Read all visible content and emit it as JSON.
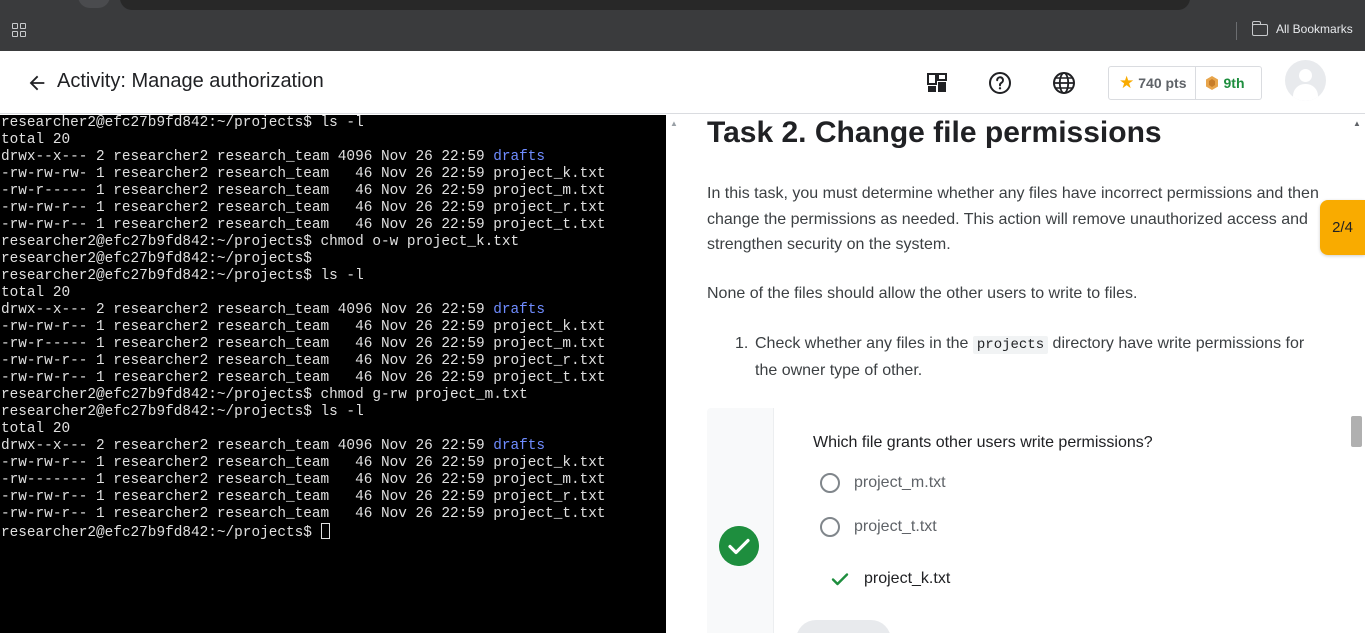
{
  "bookmarks_bar": {
    "all_bookmarks_label": "All Bookmarks"
  },
  "header": {
    "title": "Activity: Manage authorization",
    "points": "740 pts",
    "rank": "9th"
  },
  "terminal": {
    "lines": [
      [
        {
          "t": "researcher2@efc27b9fd842:~/projects$ ls -l"
        }
      ],
      [
        {
          "t": "total 20"
        }
      ],
      [
        {
          "t": "drwx--x--- 2 researcher2 research_team 4096 Nov 26 22:59 "
        },
        {
          "t": "drafts",
          "c": "dir"
        }
      ],
      [
        {
          "t": "-rw-rw-rw- 1 researcher2 research_team   46 Nov 26 22:59 project_k.txt"
        }
      ],
      [
        {
          "t": "-rw-r----- 1 researcher2 research_team   46 Nov 26 22:59 project_m.txt"
        }
      ],
      [
        {
          "t": "-rw-rw-r-- 1 researcher2 research_team   46 Nov 26 22:59 project_r.txt"
        }
      ],
      [
        {
          "t": "-rw-rw-r-- 1 researcher2 research_team   46 Nov 26 22:59 project_t.txt"
        }
      ],
      [
        {
          "t": "researcher2@efc27b9fd842:~/projects$ chmod o-w project_k.txt"
        }
      ],
      [
        {
          "t": "researcher2@efc27b9fd842:~/projects$"
        }
      ],
      [
        {
          "t": "researcher2@efc27b9fd842:~/projects$ ls -l"
        }
      ],
      [
        {
          "t": "total 20"
        }
      ],
      [
        {
          "t": "drwx--x--- 2 researcher2 research_team 4096 Nov 26 22:59 "
        },
        {
          "t": "drafts",
          "c": "dir"
        }
      ],
      [
        {
          "t": "-rw-rw-r-- 1 researcher2 research_team   46 Nov 26 22:59 project_k.txt"
        }
      ],
      [
        {
          "t": "-rw-r----- 1 researcher2 research_team   46 Nov 26 22:59 project_m.txt"
        }
      ],
      [
        {
          "t": "-rw-rw-r-- 1 researcher2 research_team   46 Nov 26 22:59 project_r.txt"
        }
      ],
      [
        {
          "t": "-rw-rw-r-- 1 researcher2 research_team   46 Nov 26 22:59 project_t.txt"
        }
      ],
      [
        {
          "t": "researcher2@efc27b9fd842:~/projects$ chmod g-rw project_m.txt"
        }
      ],
      [
        {
          "t": "researcher2@efc27b9fd842:~/projects$ ls -l"
        }
      ],
      [
        {
          "t": "total 20"
        }
      ],
      [
        {
          "t": "drwx--x--- 2 researcher2 research_team 4096 Nov 26 22:59 "
        },
        {
          "t": "drafts",
          "c": "dir"
        }
      ],
      [
        {
          "t": "-rw-rw-r-- 1 researcher2 research_team   46 Nov 26 22:59 project_k.txt"
        }
      ],
      [
        {
          "t": "-rw------- 1 researcher2 research_team   46 Nov 26 22:59 project_m.txt"
        }
      ],
      [
        {
          "t": "-rw-rw-r-- 1 researcher2 research_team   46 Nov 26 22:59 project_r.txt"
        }
      ],
      [
        {
          "t": "-rw-rw-r-- 1 researcher2 research_team   46 Nov 26 22:59 project_t.txt"
        }
      ],
      [
        {
          "t": "researcher2@efc27b9fd842:~/projects$ "
        },
        {
          "t": "",
          "c": "cursor"
        }
      ]
    ]
  },
  "content": {
    "task_title": "Task 2. Change file permissions",
    "paragraph1": "In this task, you must determine whether any files have incorrect permissions and then change the permissions as needed. This action will remove unauthorized access and strengthen security on the system.",
    "paragraph2": "None of the files should allow the other users to write to files.",
    "step1": {
      "number": "1.",
      "before": "Check whether any files in the ",
      "code": "projects",
      "after": " directory have write permissions for the owner type of other."
    },
    "quiz": {
      "question": "Which file grants other users write permissions?",
      "options": [
        {
          "label": "project_m.txt",
          "state": "unselected"
        },
        {
          "label": "project_t.txt",
          "state": "unselected"
        },
        {
          "label": "project_k.txt",
          "state": "correct"
        }
      ]
    }
  },
  "progress_tab": {
    "label": "2/4"
  },
  "colors": {
    "accent_green": "#1e8e3e",
    "star_yellow": "#f9ab00",
    "terminal_dir": "#6f8cff"
  },
  "icons": {
    "back": "arrow-left-icon",
    "dashboard": "dashboard-icon",
    "help": "help-circle-icon",
    "language": "globe-icon",
    "points": "star-icon",
    "rank": "badge-icon",
    "quiz_status": "check-circle-icon"
  }
}
